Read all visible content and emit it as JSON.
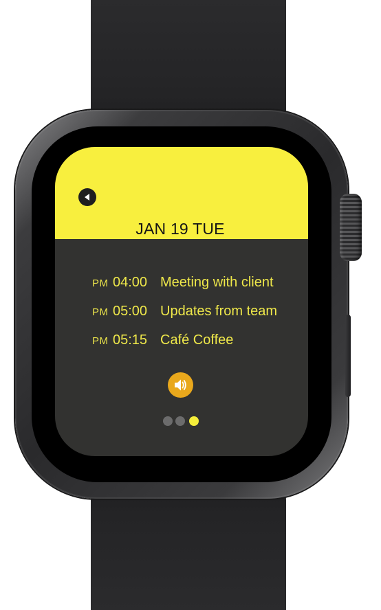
{
  "header": {
    "date": "JAN 19 TUE",
    "accent_color": "#f8ef3e"
  },
  "events": [
    {
      "ampm": "PM",
      "time": "04:00",
      "title": "Meeting with client"
    },
    {
      "ampm": "PM",
      "time": "05:00",
      "title": "Updates from team"
    },
    {
      "ampm": "PM",
      "time": "05:15",
      "title": "Café Coffee"
    }
  ],
  "controls": {
    "back_icon": "back-arrow-icon",
    "speaker_icon": "speaker-icon",
    "speaker_color": "#e9a81c"
  },
  "pagination": {
    "total": 3,
    "active_index": 2
  }
}
